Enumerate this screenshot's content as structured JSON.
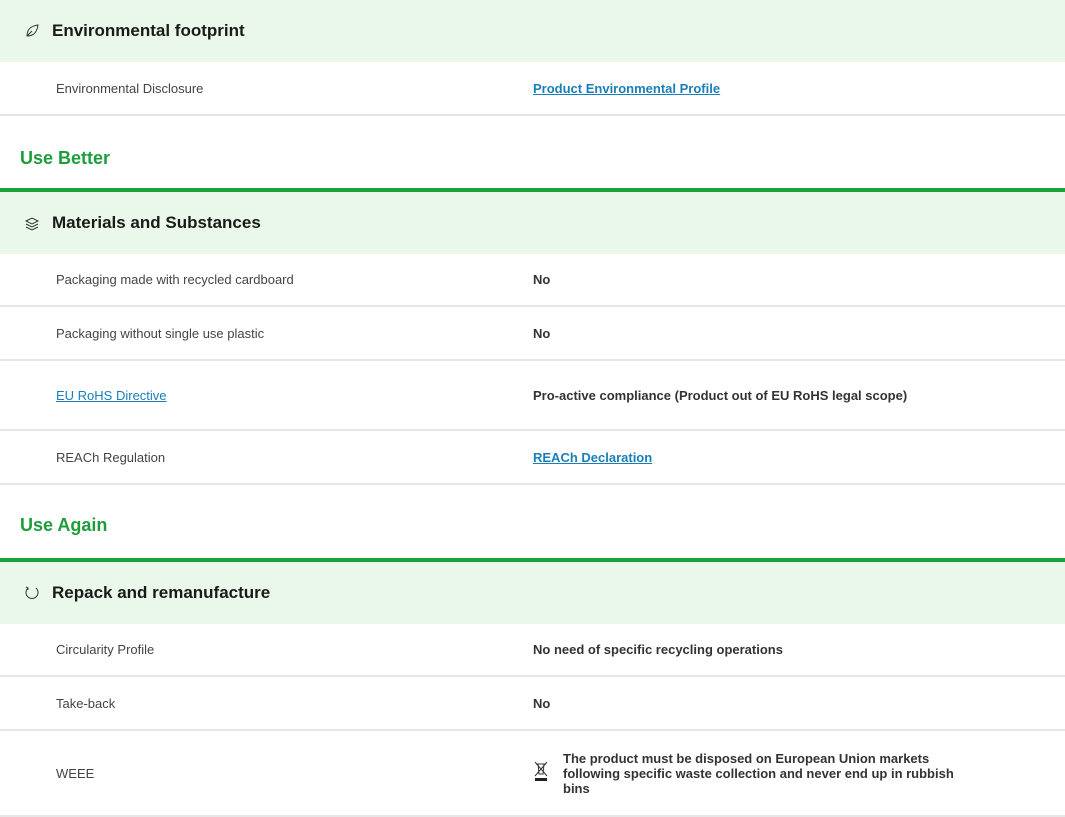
{
  "sections": {
    "footprint": {
      "title": "Environmental footprint",
      "icon": "leaf-icon",
      "rows": [
        {
          "label": "Environmental Disclosure",
          "value": "Product Environmental Profile"
        }
      ]
    },
    "use_better": {
      "group_title": "Use Better",
      "title": "Materials and Substances",
      "icon": "layers-icon",
      "rows": [
        {
          "label": "Packaging made with recycled cardboard",
          "value": "No"
        },
        {
          "label": "Packaging without single use plastic",
          "value": "No"
        },
        {
          "label": "EU RoHS Directive",
          "value": "Pro-active compliance (Product out of EU RoHS legal scope)"
        },
        {
          "label": "REACh Regulation",
          "value": "REACh Declaration"
        }
      ]
    },
    "use_again": {
      "group_title": "Use Again",
      "title": "Repack and remanufacture",
      "icon": "refresh-icon",
      "rows": [
        {
          "label": "Circularity Profile",
          "value": "No need of specific recycling operations"
        },
        {
          "label": "Take-back",
          "value": "No"
        },
        {
          "label": "WEEE",
          "value": "The product must be disposed on European Union markets following specific waste collection and never end up in rubbish bins"
        }
      ]
    }
  },
  "colors": {
    "accent_green": "#17a33a",
    "header_bg": "#e9f8ea",
    "link_blue": "#1a7fb8"
  }
}
